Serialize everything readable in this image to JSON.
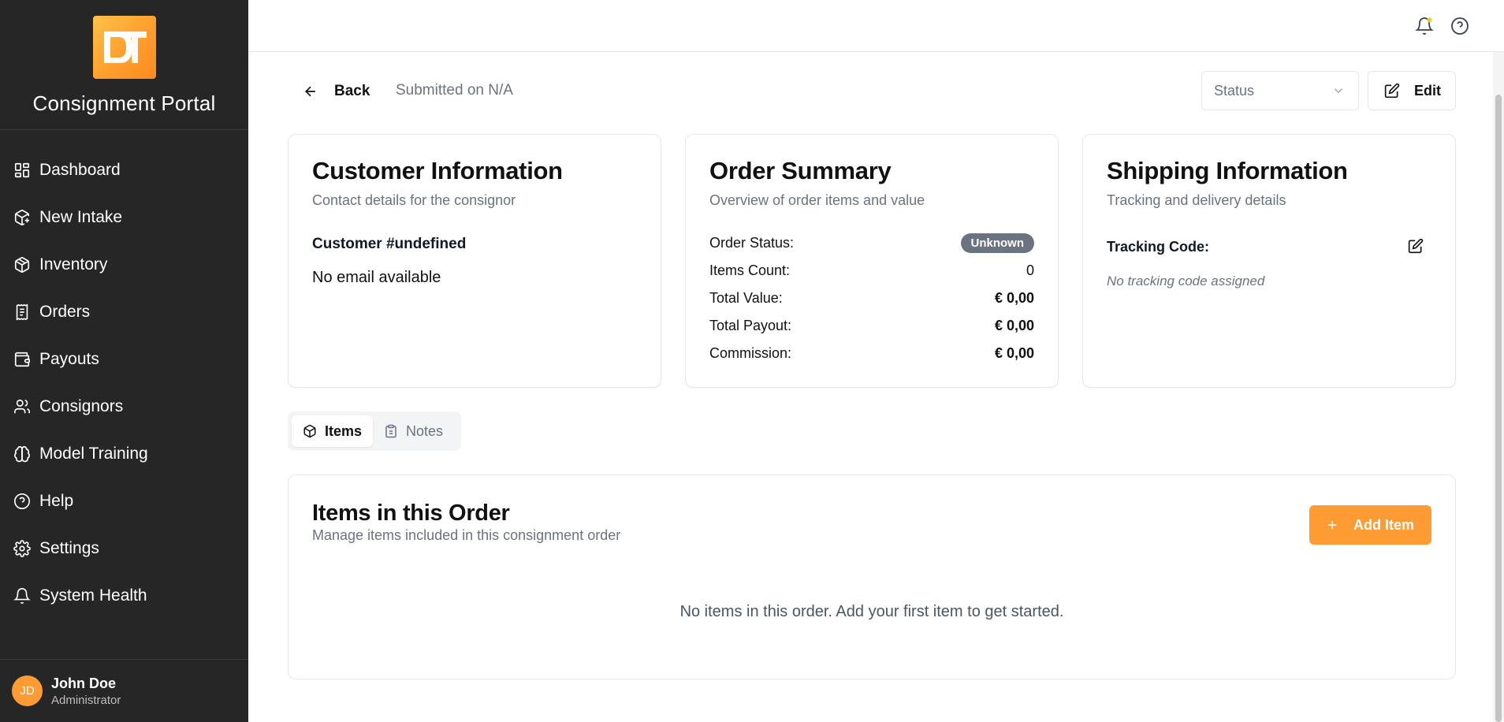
{
  "app": {
    "title": "Consignment Portal",
    "accent_color": "#ff9b33"
  },
  "sidebar": {
    "items": [
      {
        "label": "Dashboard",
        "icon": "grid-icon"
      },
      {
        "label": "New Intake",
        "icon": "package-plus-icon"
      },
      {
        "label": "Inventory",
        "icon": "package-icon"
      },
      {
        "label": "Orders",
        "icon": "receipt-icon"
      },
      {
        "label": "Payouts",
        "icon": "wallet-icon"
      },
      {
        "label": "Consignors",
        "icon": "users-icon"
      },
      {
        "label": "Model Training",
        "icon": "brain-icon"
      },
      {
        "label": "Help",
        "icon": "help-circle-icon"
      },
      {
        "label": "Settings",
        "icon": "gear-icon"
      },
      {
        "label": "System Health",
        "icon": "bell-icon"
      }
    ]
  },
  "user": {
    "initials": "JD",
    "name": "John Doe",
    "role": "Administrator"
  },
  "header": {
    "back_label": "Back",
    "submitted_text": "Submitted on N/A",
    "status_placeholder": "Status",
    "edit_label": "Edit"
  },
  "customer": {
    "title": "Customer Information",
    "subtitle": "Contact details for the consignor",
    "id_text": "Customer #undefined",
    "email_text": "No email available"
  },
  "summary": {
    "title": "Order Summary",
    "subtitle": "Overview of order items and value",
    "rows": [
      {
        "label": "Order Status:",
        "value": "Unknown"
      },
      {
        "label": "Items Count:",
        "value": "0"
      },
      {
        "label": "Total Value:",
        "value": "€ 0,00"
      },
      {
        "label": "Total Payout:",
        "value": "€ 0,00"
      },
      {
        "label": "Commission:",
        "value": "€ 0,00"
      }
    ]
  },
  "shipping": {
    "title": "Shipping Information",
    "subtitle": "Tracking and delivery details",
    "tracking_label": "Tracking Code:",
    "tracking_empty": "No tracking code assigned"
  },
  "tabs": [
    {
      "label": "Items",
      "active": true
    },
    {
      "label": "Notes",
      "active": false
    }
  ],
  "items_section": {
    "title": "Items in this Order",
    "subtitle": "Manage items included in this consignment order",
    "add_label": "Add Item",
    "empty_text": "No items in this order. Add your first item to get started."
  }
}
